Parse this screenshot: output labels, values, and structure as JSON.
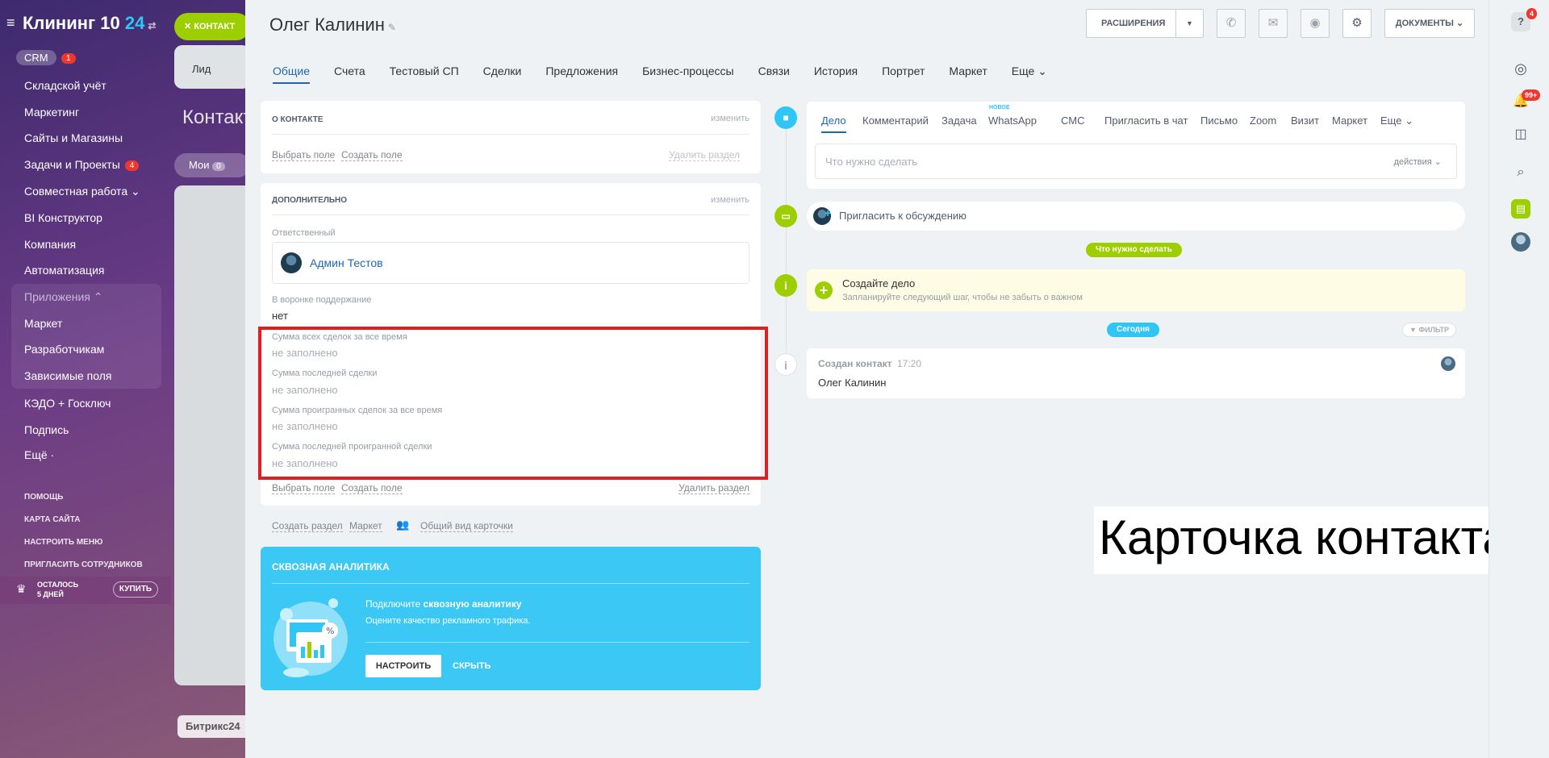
{
  "portal": {
    "logo_name": "Клининг 10",
    "logo_suffix": "24",
    "crm_label": "CRM",
    "crm_badge": "1",
    "menu": [
      {
        "label": "Складской учёт"
      },
      {
        "label": "Маркетинг"
      },
      {
        "label": "Сайты и Магазины"
      },
      {
        "label": "Задачи и Проекты",
        "badge": "4"
      },
      {
        "label": "Совместная работа ⌄"
      },
      {
        "label": "BI Конструктор"
      },
      {
        "label": "Компания"
      },
      {
        "label": "Автоматизация"
      },
      {
        "label": "Приложения ⌃"
      },
      {
        "label": "Маркет"
      },
      {
        "label": "Разработчикам"
      },
      {
        "label": "Зависимые поля"
      },
      {
        "label": "КЭДО + Госключ"
      },
      {
        "label": "Подпись"
      },
      {
        "label": "Ещё ·"
      }
    ],
    "small_links": [
      "Помощь",
      "Карта сайта",
      "Настроить меню",
      "Пригласить сотрудников"
    ],
    "trial_line1": "ОСТАЛОСЬ",
    "trial_line2": "5 ДНЕЙ",
    "buy_label": "КУПИТЬ",
    "bg_contact_btn": "✕ КОНТАКТ",
    "bg_lead": "Лид",
    "bg_title": "Контакт",
    "bg_tab": "Мои",
    "bg_tab_count": "0",
    "bg_footer": "Битрикс24"
  },
  "slider": {
    "title": "Олег Калинин",
    "buttons": {
      "extensions": "РАСШИРЕНИЯ",
      "documents": "ДОКУМЕНТЫ"
    },
    "tabs": [
      "Общие",
      "Счета",
      "Тестовый СП",
      "Сделки",
      "Предложения",
      "Бизнес-процессы",
      "Связи",
      "История",
      "Портрет",
      "Маркет",
      "Еще ⌄"
    ],
    "about": {
      "title": "О КОНТАКТЕ",
      "edit": "изменить",
      "select_field": "Выбрать поле",
      "create_field": "Создать поле",
      "delete_section": "Удалить раздел"
    },
    "extra": {
      "title": "ДОПОЛНИТЕЛЬНО",
      "edit": "изменить",
      "responsible_label": "Ответственный",
      "responsible_name": "Админ Тестов",
      "funnel_label": "В воронке поддержание",
      "funnel_value": "нет",
      "fields": [
        {
          "label": "Сумма всех сделок за все время",
          "value": "не заполнено"
        },
        {
          "label": "Сумма последней сделки",
          "value": "не заполнено"
        },
        {
          "label": "Сумма проигранных сделок за все время",
          "value": "не заполнено"
        },
        {
          "label": "Сумма последней проигранной сделки",
          "value": "не заполнено"
        }
      ],
      "select_field": "Выбрать поле",
      "create_field": "Создать поле",
      "delete_section": "Удалить раздел"
    },
    "bottom_links": {
      "create_section": "Создать раздел",
      "market": "Маркет",
      "common_view": "Общий вид карточки"
    },
    "analytics": {
      "title": "СКВОЗНАЯ АНАЛИТИКА",
      "head_plain": "Подключите ",
      "head_bold": "сквозную аналитику",
      "sub": "Оцените качество рекламного трафика.",
      "setup": "НАСТРОИТЬ",
      "hide": "СКРЫТЬ"
    },
    "activity": {
      "tabs": [
        "Дело",
        "Комментарий",
        "Задача",
        "WhatsApp",
        "СМС",
        "Пригласить в чат",
        "Письмо",
        "Zoom",
        "Визит",
        "Маркет",
        "Еще ⌄"
      ],
      "new_label": "НОВОЕ",
      "placeholder": "Что нужно сделать",
      "actions": "действия ⌄",
      "invite": "Пригласить к обсуждению",
      "todo_badge": "Что нужно сделать",
      "create_title": "Создайте дело",
      "create_sub": "Запланируйте следующий шаг, чтобы не забыть о важном",
      "today_badge": "Сегодня",
      "filter": "ФИЛЬТР",
      "event_title": "Создан контакт",
      "event_time": "17:20",
      "event_body": "Олег Калинин"
    },
    "caption": "Карточка контакта"
  },
  "rail": {
    "help_badge": "4",
    "notif_badge": "99+"
  },
  "colors": {
    "accent_blue": "#2067b0",
    "green": "#9dcf00",
    "cyan": "#2fc6f6",
    "highlight_red": "#e02020"
  }
}
